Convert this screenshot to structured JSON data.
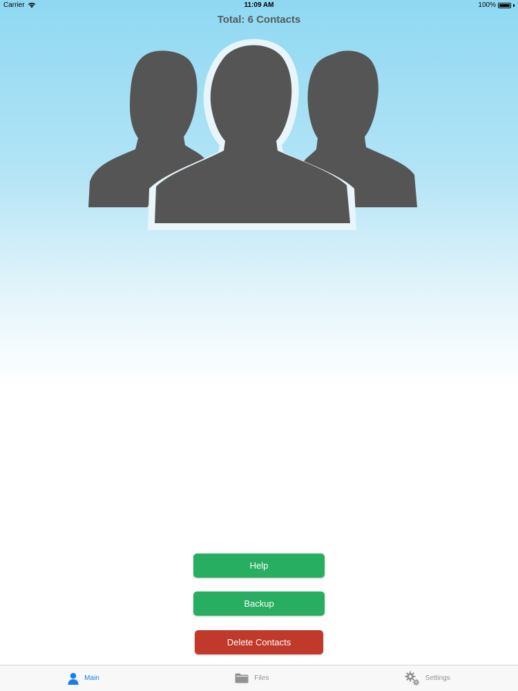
{
  "status_bar": {
    "carrier": "Carrier",
    "time": "11:09 AM",
    "battery": "100%",
    "battery_level": 1.0
  },
  "header": {
    "total_label": "Total: 6 Contacts"
  },
  "hero": {
    "icon": "contacts-group-icon",
    "color": "#555555"
  },
  "buttons": {
    "help": "Help",
    "backup": "Backup",
    "delete": "Delete Contacts"
  },
  "tab_bar": {
    "tabs": [
      {
        "label": "Main",
        "icon": "person-icon",
        "active": true
      },
      {
        "label": "Files",
        "icon": "folder-icon",
        "active": false
      },
      {
        "label": "Settings",
        "icon": "gear-icon",
        "active": false
      }
    ]
  },
  "colors": {
    "green": "#27ae60",
    "red": "#c0392b",
    "active_tab": "#1a7fe0",
    "inactive_tab": "#929292"
  }
}
